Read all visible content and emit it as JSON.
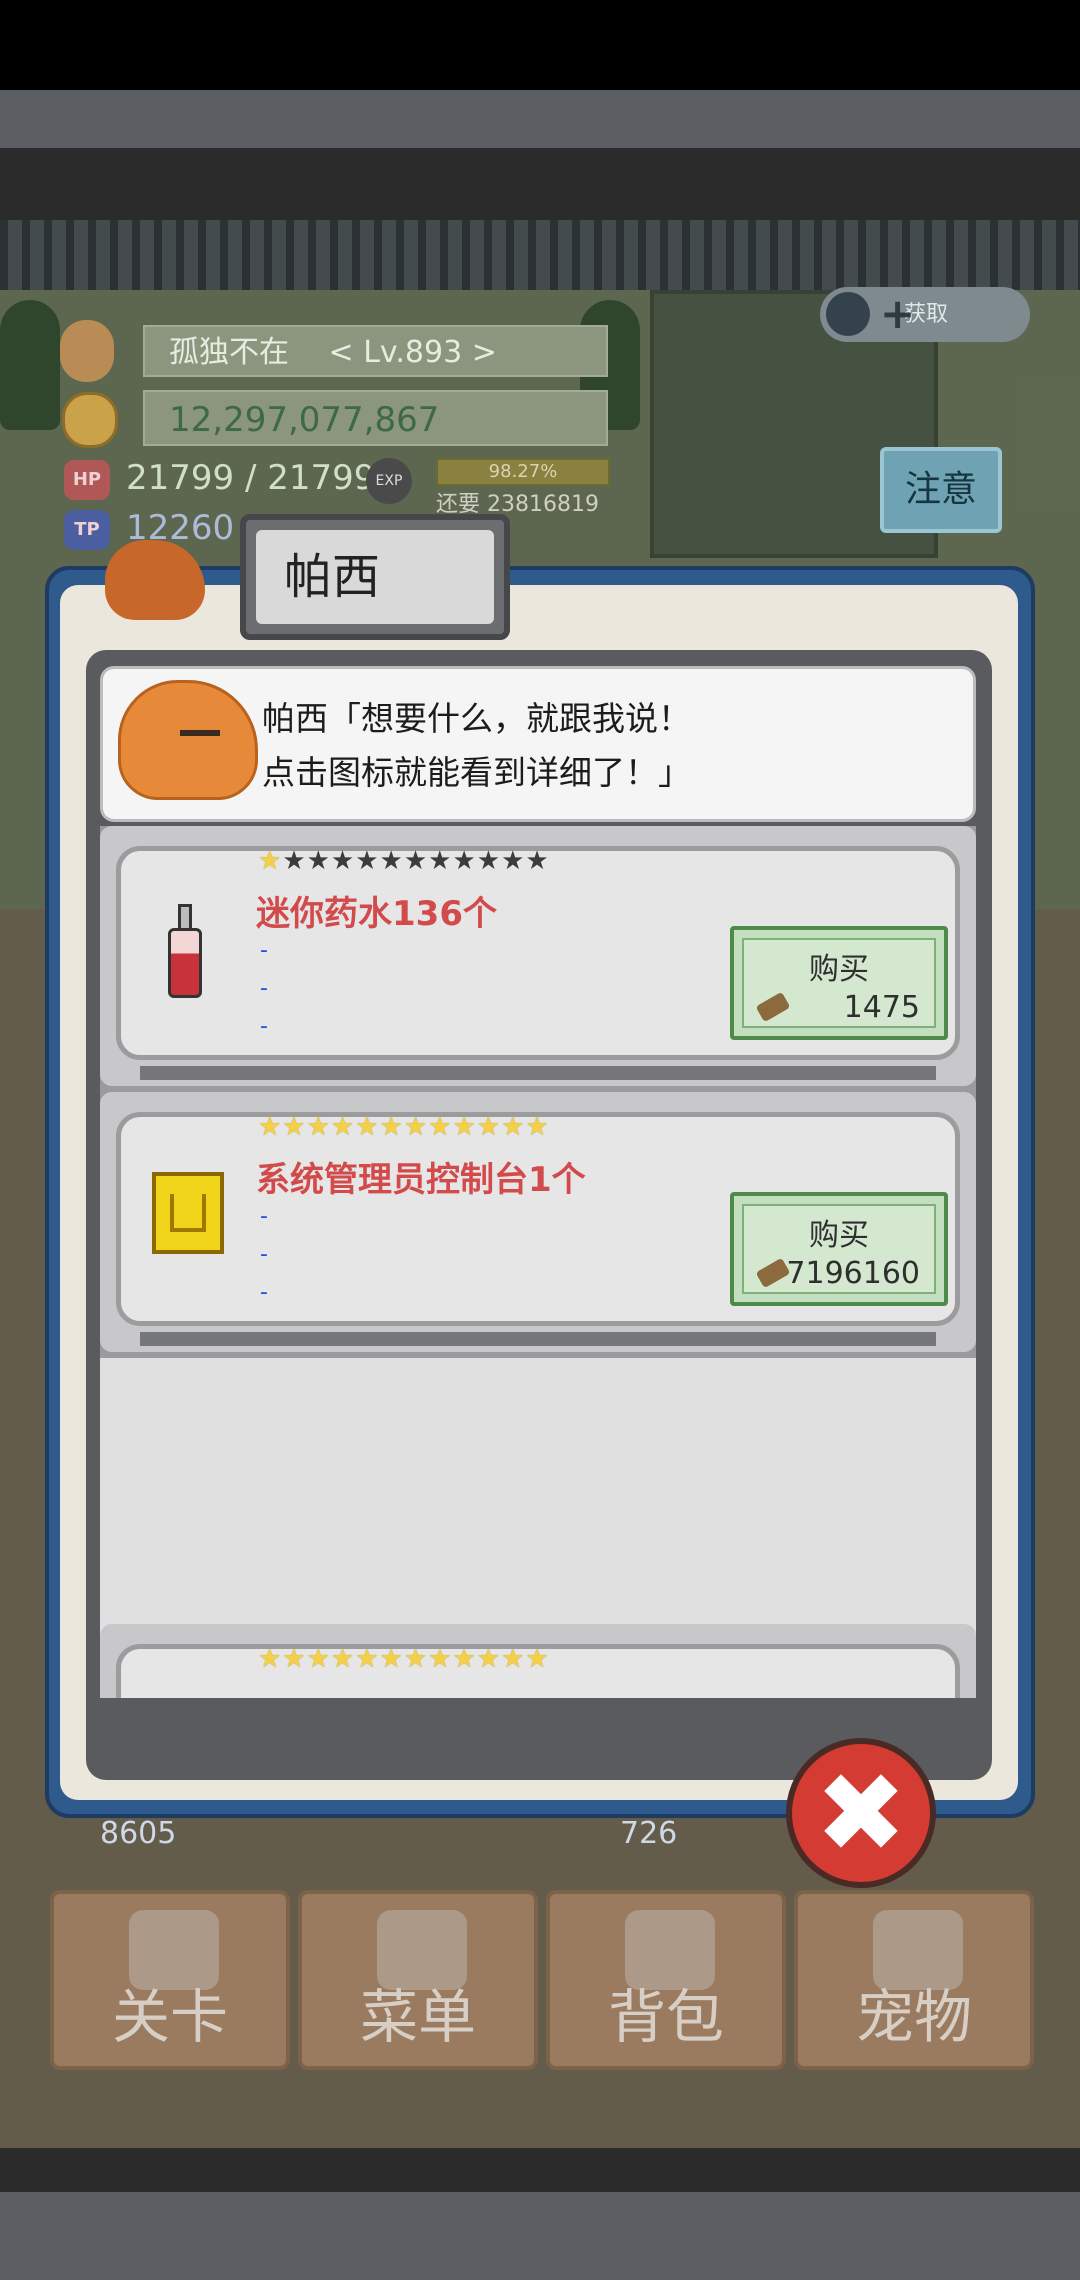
{
  "hud": {
    "player_name": "孤独不在",
    "level": "< Lv.893 >",
    "gold": "12,297,077,867",
    "hp_label": "HP",
    "hp_value": "21799 / 21799",
    "tp_label": "TP",
    "tp_value": "12260 /",
    "exp_label": "EXP",
    "exp_percent": "98.27%",
    "exp_remaining": "还要 23816819",
    "notice_button": "注意",
    "badge_text": "获取"
  },
  "dialog": {
    "tab_title": "帕西",
    "speech_line1": "帕西「想要什么，就跟我说！",
    "speech_line2": "点击图标就能看到详细了！」",
    "items": [
      {
        "name": "迷你药水136个",
        "stars_filled": 1,
        "stars_total": 12,
        "desc": [
          "-",
          "-",
          "-"
        ],
        "buy_label": "购买",
        "price": "1475"
      },
      {
        "name": "系统管理员控制台1个",
        "stars_filled": 12,
        "stars_total": 12,
        "desc": [
          "-",
          "-",
          "-"
        ],
        "buy_label": "购买",
        "price": "7196160"
      },
      {
        "name": "",
        "stars_filled": 12,
        "stars_total": 12
      }
    ],
    "close_symbol": "✖"
  },
  "nav": {
    "left_counter": "8605",
    "right_counter": "726",
    "items": [
      "关卡",
      "菜单",
      "背包",
      "宠物"
    ]
  }
}
